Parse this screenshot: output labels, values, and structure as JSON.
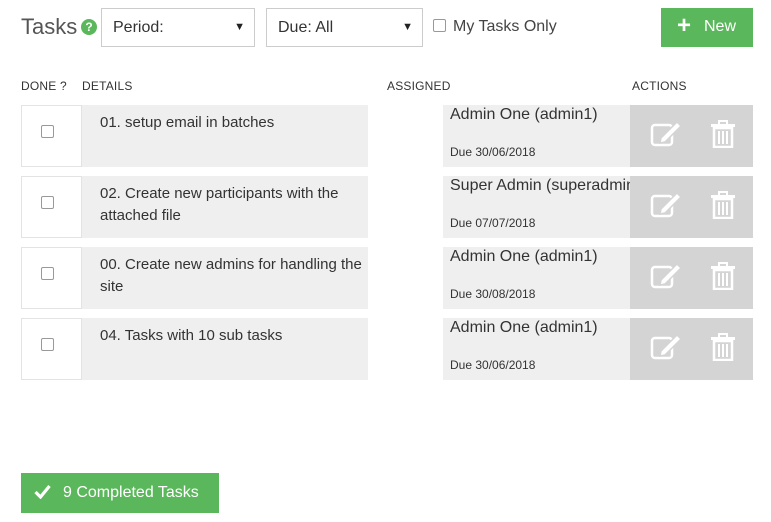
{
  "header": {
    "title": "Tasks",
    "help_icon": "question-circle-icon",
    "period_select": "Period:",
    "due_select": "Due: All",
    "my_tasks_label": "My Tasks Only",
    "new_button_label": "New"
  },
  "columns": {
    "done": "DONE ?",
    "details": "DETAILS",
    "assigned": "ASSIGNED",
    "actions": "ACTIONS"
  },
  "tasks": [
    {
      "title": "01. setup email in batches",
      "assignee": "Admin One (admin1)",
      "due": "Due 30/06/2018"
    },
    {
      "title": "02. Create new participants with the attached file",
      "assignee": "Super Admin (superadmin)",
      "due": "Due 07/07/2018"
    },
    {
      "title": "00. Create new admins for handling the site",
      "assignee": "Admin One (admin1)",
      "due": "Due 30/08/2018"
    },
    {
      "title": "04. Tasks with 10 sub tasks",
      "assignee": "Admin One (admin1)",
      "due": "Due 30/06/2018"
    }
  ],
  "footer": {
    "completed_button_label": "9 Completed Tasks"
  },
  "colors": {
    "accent_green": "#5bb75b",
    "row_grey": "#efefef",
    "actions_grey": "#d4d4d4"
  }
}
